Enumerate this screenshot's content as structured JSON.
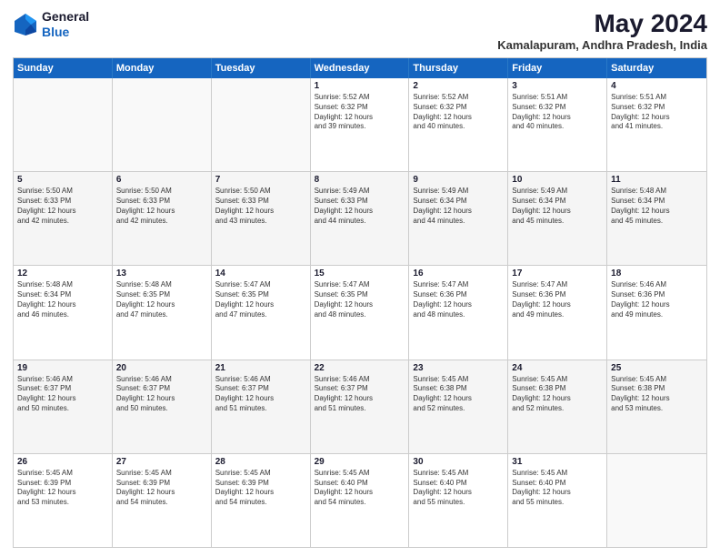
{
  "logo": {
    "general": "General",
    "blue": "Blue"
  },
  "title": "May 2024",
  "location": "Kamalapuram, Andhra Pradesh, India",
  "weekdays": [
    "Sunday",
    "Monday",
    "Tuesday",
    "Wednesday",
    "Thursday",
    "Friday",
    "Saturday"
  ],
  "rows": [
    [
      {
        "day": "",
        "info": ""
      },
      {
        "day": "",
        "info": ""
      },
      {
        "day": "",
        "info": ""
      },
      {
        "day": "1",
        "info": "Sunrise: 5:52 AM\nSunset: 6:32 PM\nDaylight: 12 hours\nand 39 minutes."
      },
      {
        "day": "2",
        "info": "Sunrise: 5:52 AM\nSunset: 6:32 PM\nDaylight: 12 hours\nand 40 minutes."
      },
      {
        "day": "3",
        "info": "Sunrise: 5:51 AM\nSunset: 6:32 PM\nDaylight: 12 hours\nand 40 minutes."
      },
      {
        "day": "4",
        "info": "Sunrise: 5:51 AM\nSunset: 6:32 PM\nDaylight: 12 hours\nand 41 minutes."
      }
    ],
    [
      {
        "day": "5",
        "info": "Sunrise: 5:50 AM\nSunset: 6:33 PM\nDaylight: 12 hours\nand 42 minutes."
      },
      {
        "day": "6",
        "info": "Sunrise: 5:50 AM\nSunset: 6:33 PM\nDaylight: 12 hours\nand 42 minutes."
      },
      {
        "day": "7",
        "info": "Sunrise: 5:50 AM\nSunset: 6:33 PM\nDaylight: 12 hours\nand 43 minutes."
      },
      {
        "day": "8",
        "info": "Sunrise: 5:49 AM\nSunset: 6:33 PM\nDaylight: 12 hours\nand 44 minutes."
      },
      {
        "day": "9",
        "info": "Sunrise: 5:49 AM\nSunset: 6:34 PM\nDaylight: 12 hours\nand 44 minutes."
      },
      {
        "day": "10",
        "info": "Sunrise: 5:49 AM\nSunset: 6:34 PM\nDaylight: 12 hours\nand 45 minutes."
      },
      {
        "day": "11",
        "info": "Sunrise: 5:48 AM\nSunset: 6:34 PM\nDaylight: 12 hours\nand 45 minutes."
      }
    ],
    [
      {
        "day": "12",
        "info": "Sunrise: 5:48 AM\nSunset: 6:34 PM\nDaylight: 12 hours\nand 46 minutes."
      },
      {
        "day": "13",
        "info": "Sunrise: 5:48 AM\nSunset: 6:35 PM\nDaylight: 12 hours\nand 47 minutes."
      },
      {
        "day": "14",
        "info": "Sunrise: 5:47 AM\nSunset: 6:35 PM\nDaylight: 12 hours\nand 47 minutes."
      },
      {
        "day": "15",
        "info": "Sunrise: 5:47 AM\nSunset: 6:35 PM\nDaylight: 12 hours\nand 48 minutes."
      },
      {
        "day": "16",
        "info": "Sunrise: 5:47 AM\nSunset: 6:36 PM\nDaylight: 12 hours\nand 48 minutes."
      },
      {
        "day": "17",
        "info": "Sunrise: 5:47 AM\nSunset: 6:36 PM\nDaylight: 12 hours\nand 49 minutes."
      },
      {
        "day": "18",
        "info": "Sunrise: 5:46 AM\nSunset: 6:36 PM\nDaylight: 12 hours\nand 49 minutes."
      }
    ],
    [
      {
        "day": "19",
        "info": "Sunrise: 5:46 AM\nSunset: 6:37 PM\nDaylight: 12 hours\nand 50 minutes."
      },
      {
        "day": "20",
        "info": "Sunrise: 5:46 AM\nSunset: 6:37 PM\nDaylight: 12 hours\nand 50 minutes."
      },
      {
        "day": "21",
        "info": "Sunrise: 5:46 AM\nSunset: 6:37 PM\nDaylight: 12 hours\nand 51 minutes."
      },
      {
        "day": "22",
        "info": "Sunrise: 5:46 AM\nSunset: 6:37 PM\nDaylight: 12 hours\nand 51 minutes."
      },
      {
        "day": "23",
        "info": "Sunrise: 5:45 AM\nSunset: 6:38 PM\nDaylight: 12 hours\nand 52 minutes."
      },
      {
        "day": "24",
        "info": "Sunrise: 5:45 AM\nSunset: 6:38 PM\nDaylight: 12 hours\nand 52 minutes."
      },
      {
        "day": "25",
        "info": "Sunrise: 5:45 AM\nSunset: 6:38 PM\nDaylight: 12 hours\nand 53 minutes."
      }
    ],
    [
      {
        "day": "26",
        "info": "Sunrise: 5:45 AM\nSunset: 6:39 PM\nDaylight: 12 hours\nand 53 minutes."
      },
      {
        "day": "27",
        "info": "Sunrise: 5:45 AM\nSunset: 6:39 PM\nDaylight: 12 hours\nand 54 minutes."
      },
      {
        "day": "28",
        "info": "Sunrise: 5:45 AM\nSunset: 6:39 PM\nDaylight: 12 hours\nand 54 minutes."
      },
      {
        "day": "29",
        "info": "Sunrise: 5:45 AM\nSunset: 6:40 PM\nDaylight: 12 hours\nand 54 minutes."
      },
      {
        "day": "30",
        "info": "Sunrise: 5:45 AM\nSunset: 6:40 PM\nDaylight: 12 hours\nand 55 minutes."
      },
      {
        "day": "31",
        "info": "Sunrise: 5:45 AM\nSunset: 6:40 PM\nDaylight: 12 hours\nand 55 minutes."
      },
      {
        "day": "",
        "info": ""
      }
    ]
  ],
  "colors": {
    "header_bg": "#1565c0",
    "header_text": "#ffffff",
    "border": "#cccccc",
    "alt_bg": "#f5f5f5",
    "empty_bg": "#f9f9f9"
  }
}
